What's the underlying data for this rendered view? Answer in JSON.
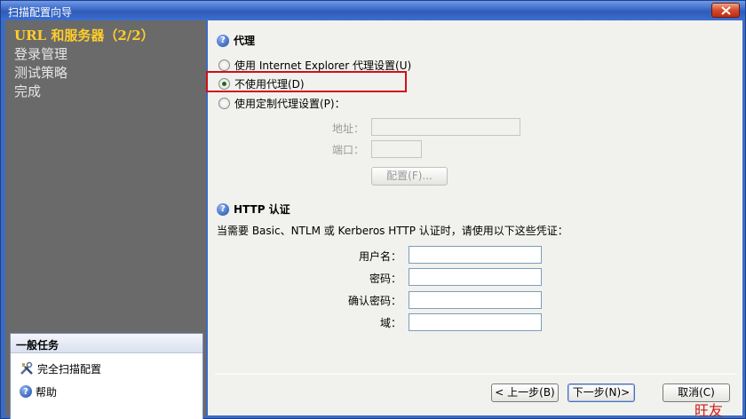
{
  "window": {
    "title": "扫描配置向导"
  },
  "sidebar": {
    "steps": [
      {
        "label": "URL 和服务器（2/2）",
        "active": true
      },
      {
        "label": "登录管理"
      },
      {
        "label": "测试策略"
      },
      {
        "label": "完成"
      }
    ],
    "tasks": {
      "header": "一般任务",
      "items": [
        {
          "label": "完全扫描配置",
          "icon": "tools-icon"
        },
        {
          "label": "帮助",
          "icon": "help-icon"
        }
      ]
    }
  },
  "proxy": {
    "title": "代理",
    "options": [
      {
        "label": "使用 Internet Explorer 代理设置(U)",
        "checked": false
      },
      {
        "label": "不使用代理(D)",
        "checked": true
      },
      {
        "label": "使用定制代理设置(P)：",
        "checked": false
      }
    ],
    "address_label": "地址：",
    "port_label": "端口：",
    "config_button": "配置(F)..."
  },
  "http_auth": {
    "title": "HTTP 认证",
    "description": "当需要 Basic、NTLM 或 Kerberos HTTP 认证时，请使用以下这些凭证：",
    "fields": {
      "username_label": "用户名：",
      "password_label": "密码：",
      "confirm_label": "确认密码：",
      "domain_label": "域："
    }
  },
  "footer": {
    "back_label": "< 上一步(B)",
    "next_label": "下一步(N)>",
    "cancel_label": "取消(C)"
  },
  "watermark": "旺友",
  "colors": {
    "accent": "#ffce2a",
    "highlight": "#d0101a",
    "titlebar": "#3a67c6"
  }
}
